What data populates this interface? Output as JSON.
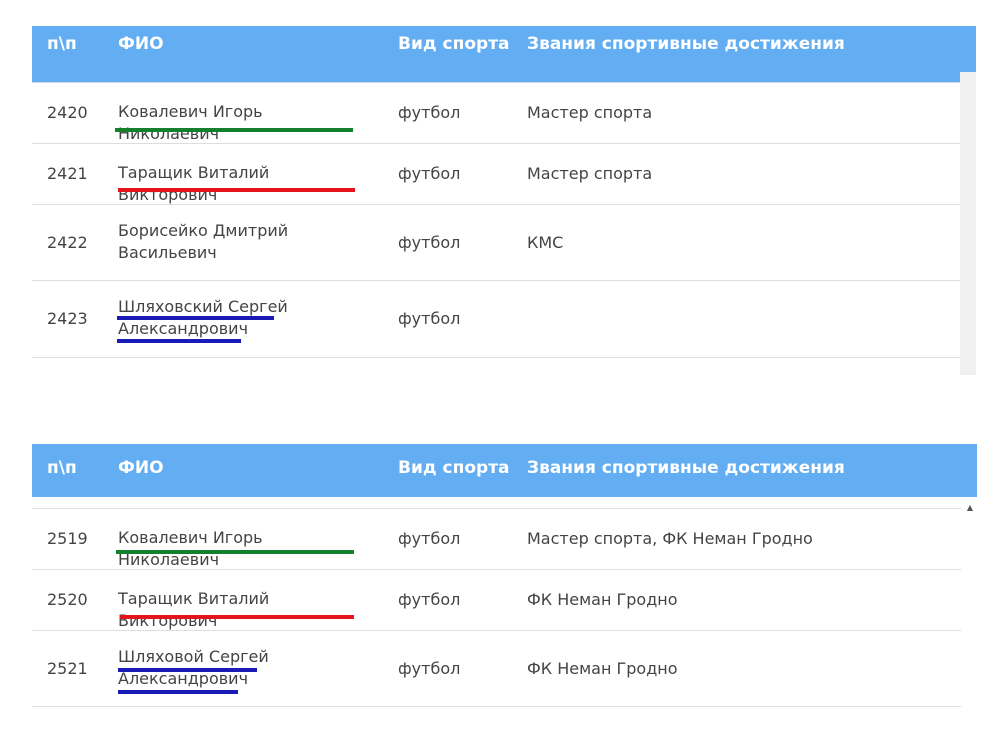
{
  "headers": {
    "num": "п\\п",
    "fio": "ФИО",
    "sport": "Вид спорта",
    "title": "Звания спортивные достижения"
  },
  "table1": {
    "rows": [
      {
        "num": "2420",
        "fio": "Ковалевич Игорь Николаевич",
        "sport": "футбол",
        "title": "Мастер спорта"
      },
      {
        "num": "2421",
        "fio": "Таращик Виталий Викторович",
        "sport": "футбол",
        "title": "Мастер спорта"
      },
      {
        "num": "2422",
        "fio": "Борисейко Дмитрий Васильевич",
        "sport": "футбол",
        "title": "КМС"
      },
      {
        "num": "2423",
        "fio": "Шляховский Сергей Александрович",
        "sport": "футбол",
        "title": ""
      }
    ]
  },
  "table2": {
    "rows": [
      {
        "num": "2519",
        "fio": "Ковалевич Игорь Николаевич",
        "sport": "футбол",
        "title": "Мастер спорта, ФК Неман Гродно"
      },
      {
        "num": "2520",
        "fio": "Таращик Виталий Викторович",
        "sport": "футбол",
        "title": "ФК Неман Гродно"
      },
      {
        "num": "2521",
        "fio": "Шляховой Сергей Александрович",
        "sport": "футбол",
        "title": "ФК Неман Гродно"
      }
    ]
  },
  "colors": {
    "header_bg": "#63adf2",
    "underline_green": "#13802b",
    "underline_red": "#e5141b",
    "underline_blue": "#1a1ab8"
  },
  "icons": {
    "scroll_up": "scroll-up-arrow-icon"
  }
}
